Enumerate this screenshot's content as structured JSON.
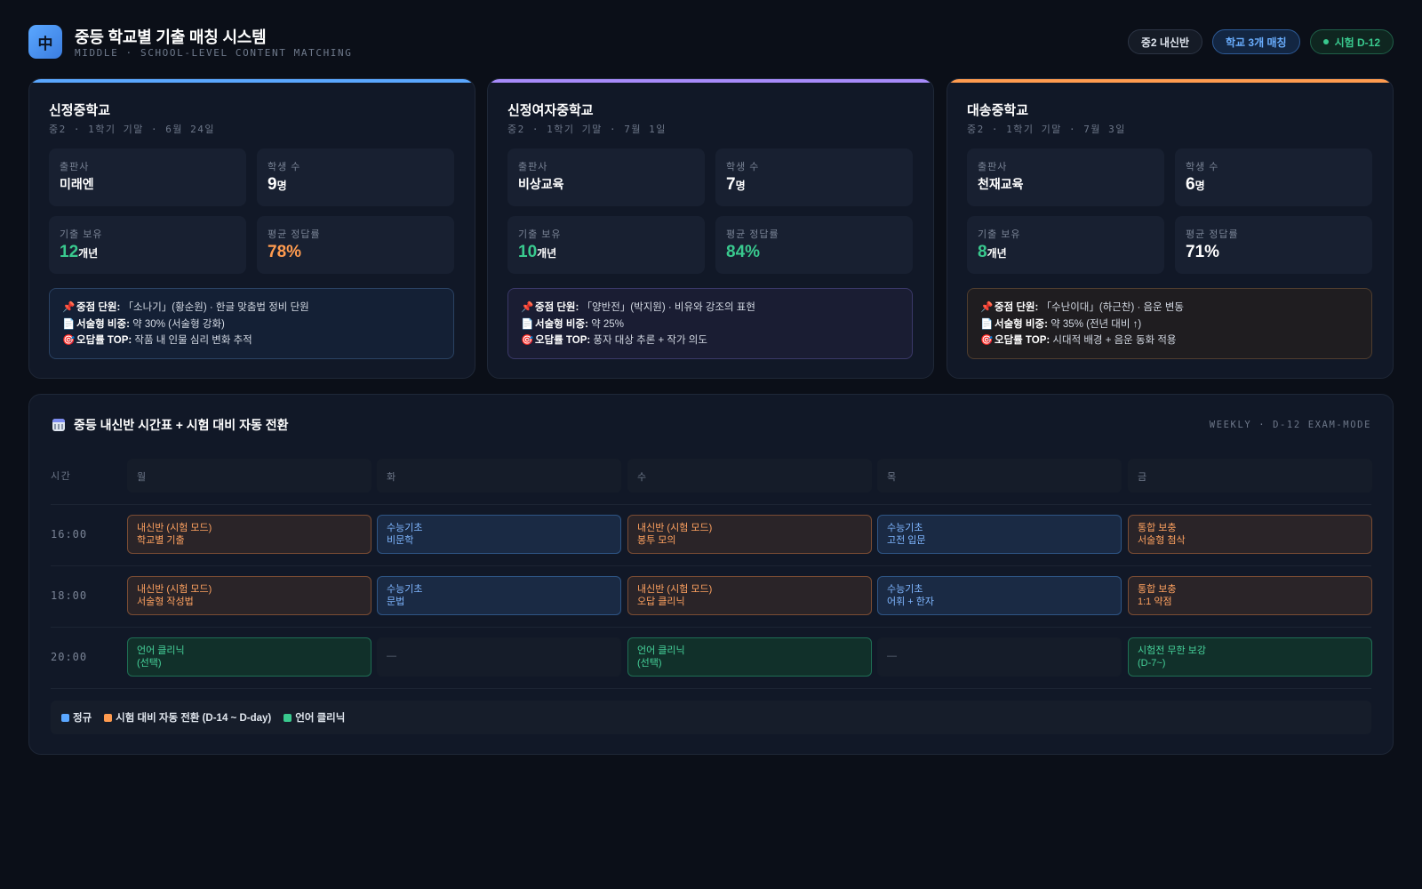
{
  "header": {
    "logo": "中",
    "title": "중등 학교별 기출 매칭 시스템",
    "subtitle": "MIDDLE · SCHOOL-LEVEL CONTENT MATCHING",
    "pills": {
      "grade": "중2 내신반",
      "match": "학교 3개 매칭",
      "exam": "시험 D-12"
    }
  },
  "schools": [
    {
      "name": "신정중학교",
      "meta": "중2 · 1학기 기말 · 6월 24일",
      "publisher_label": "출판사",
      "publisher": "미래엔",
      "students_label": "학생 수",
      "students": "9",
      "students_unit": "명",
      "past_label": "기출 보유",
      "past": "12",
      "past_unit": "개년",
      "rate_label": "평균 정답률",
      "rate": "78",
      "rate_unit": "%",
      "focus_label": "중점 단원:",
      "focus": "「소나기」(황순원) · 한글 맞춤법 정비 단원",
      "essay_label": "서술형 비중:",
      "essay": "약 30% (서술형 강화)",
      "wrong_label": "오답률 TOP:",
      "wrong": "작품 내 인물 심리 변화 추적"
    },
    {
      "name": "신정여자중학교",
      "meta": "중2 · 1학기 기말 · 7월 1일",
      "publisher_label": "출판사",
      "publisher": "비상교육",
      "students_label": "학생 수",
      "students": "7",
      "students_unit": "명",
      "past_label": "기출 보유",
      "past": "10",
      "past_unit": "개년",
      "rate_label": "평균 정답률",
      "rate": "84",
      "rate_unit": "%",
      "focus_label": "중점 단원:",
      "focus": "「양반전」(박지원) · 비유와 강조의 표현",
      "essay_label": "서술형 비중:",
      "essay": "약 25%",
      "wrong_label": "오답률 TOP:",
      "wrong": "풍자 대상 추론 + 작가 의도"
    },
    {
      "name": "대송중학교",
      "meta": "중2 · 1학기 기말 · 7월 3일",
      "publisher_label": "출판사",
      "publisher": "천재교육",
      "students_label": "학생 수",
      "students": "6",
      "students_unit": "명",
      "past_label": "기출 보유",
      "past": "8",
      "past_unit": "개년",
      "rate_label": "평균 정답률",
      "rate": "71",
      "rate_unit": "%",
      "focus_label": "중점 단원:",
      "focus": "「수난이대」(하근찬) · 음운 변동",
      "essay_label": "서술형 비중:",
      "essay": "약 35% (전년 대비 ↑)",
      "wrong_label": "오답률 TOP:",
      "wrong": "시대적 배경 + 음운 동화 적용"
    }
  ],
  "colors": {
    "accent_school_1": "#5aa7ff",
    "accent_school_2": "#a78bfa",
    "accent_school_3": "#ff9b4f",
    "regular": "#5aa7ff",
    "exam": "#ff9b4f",
    "clinic": "#39c98e"
  },
  "timetable": {
    "title": "중등 내신반 시간표 + 시험 대비 자동 전환",
    "tag": "WEEKLY · D-12 EXAM-MODE",
    "time_header": "시간",
    "days": [
      "월",
      "화",
      "수",
      "목",
      "금"
    ],
    "rows": [
      {
        "time": "16:00",
        "cells": [
          {
            "type": "exam",
            "l1": "내신반 (시험 모드)",
            "l2": "학교별 기출"
          },
          {
            "type": "regular",
            "l1": "수능기초",
            "l2": "비문학"
          },
          {
            "type": "exam",
            "l1": "내신반 (시험 모드)",
            "l2": "봉투 모의"
          },
          {
            "type": "regular",
            "l1": "수능기초",
            "l2": "고전 입문"
          },
          {
            "type": "exam",
            "l1": "통합 보충",
            "l2": "서술형 첨삭"
          }
        ]
      },
      {
        "time": "18:00",
        "cells": [
          {
            "type": "exam",
            "l1": "내신반 (시험 모드)",
            "l2": "서술형 작성법"
          },
          {
            "type": "regular",
            "l1": "수능기초",
            "l2": "문법"
          },
          {
            "type": "exam",
            "l1": "내신반 (시험 모드)",
            "l2": "오답 클리닉"
          },
          {
            "type": "regular",
            "l1": "수능기초",
            "l2": "어휘 + 한자"
          },
          {
            "type": "exam",
            "l1": "통합 보충",
            "l2": "1:1 약점"
          }
        ]
      },
      {
        "time": "20:00",
        "cells": [
          {
            "type": "clinic",
            "l1": "언어 클리닉",
            "l2": "(선택)"
          },
          {
            "type": "empty",
            "l1": "—",
            "l2": ""
          },
          {
            "type": "clinic",
            "l1": "언어 클리닉",
            "l2": "(선택)"
          },
          {
            "type": "empty",
            "l1": "—",
            "l2": ""
          },
          {
            "type": "clinic",
            "l1": "시험전 무한 보강",
            "l2": "(D-7~)"
          }
        ]
      }
    ],
    "legend": {
      "regular": "정규",
      "exam": "시험 대비 자동 전환 (D-14 ~ D-day)",
      "clinic": "언어 클리닉"
    }
  }
}
